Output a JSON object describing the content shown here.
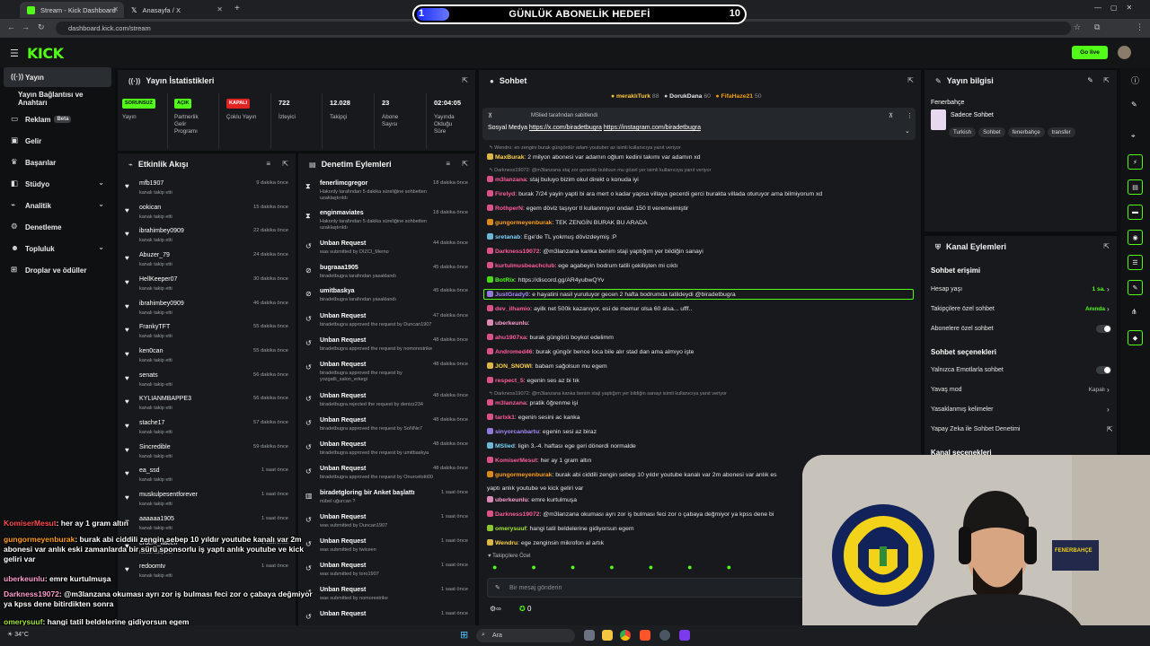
{
  "browser": {
    "tabs": [
      {
        "title": "Stream - Kick Dashboard",
        "active": true
      },
      {
        "title": "Anasayfa / X",
        "active": false
      }
    ],
    "url": "dashboard.kick.com/stream"
  },
  "goal": {
    "title": "GÜNLÜK ABONELİK HEDEFİ",
    "current": "1",
    "target": "10",
    "progress": 0.1
  },
  "header": {
    "logo": "KICK",
    "go_live": "Go live"
  },
  "sidebar": {
    "items": [
      {
        "label": "Yayın",
        "icon": "broadcast-icon",
        "active": true
      },
      {
        "label": "Yayın Bağlantısı ve Anahtarı",
        "icon": ""
      },
      {
        "label": "Reklam",
        "icon": "ad-icon",
        "badge": "Beta"
      },
      {
        "label": "Gelir",
        "icon": "revenue-icon"
      },
      {
        "label": "Başarılar",
        "icon": "trophy-icon"
      },
      {
        "label": "Stüdyo",
        "icon": "studio-icon",
        "expand": true
      },
      {
        "label": "Analitik",
        "icon": "analytics-icon",
        "expand": true
      },
      {
        "label": "Denetleme",
        "icon": "moderation-icon"
      },
      {
        "label": "Topluluk",
        "icon": "community-icon",
        "expand": true
      },
      {
        "label": "Droplar ve ödüller",
        "icon": "gift-icon"
      }
    ]
  },
  "stats": {
    "title": "Yayın İstatistikleri",
    "items": [
      {
        "badge": "SORUNSUZ",
        "label": "Yayın",
        "color": "green"
      },
      {
        "badge": "AÇIK",
        "label": "Partnerlik Gelir Programı",
        "color": "green"
      },
      {
        "badge": "KAPALI",
        "label": "Çoklu Yayın",
        "color": "red"
      },
      {
        "value": "722",
        "label": "İzleyici"
      },
      {
        "value": "12.028",
        "label": "Takipçi"
      },
      {
        "value": "23",
        "label": "Abone Sayısı"
      },
      {
        "value": "02:04:05",
        "label": "Yayında Olduğu Süre"
      }
    ]
  },
  "activity": {
    "title": "Etkinlik Akışı",
    "rows": [
      {
        "name": "mfb1907",
        "sub": "kanalı takip etti",
        "time": "9 dakika önce"
      },
      {
        "name": "ookican",
        "sub": "kanalı takip etti",
        "time": "15 dakika önce"
      },
      {
        "name": "ibrahimbey0909",
        "sub": "kanalı takip etti",
        "time": "22 dakika önce"
      },
      {
        "name": "Abuzer_79",
        "sub": "kanalı takip etti",
        "time": "24 dakika önce"
      },
      {
        "name": "HellKeeper07",
        "sub": "kanalı takip etti",
        "time": "30 dakika önce"
      },
      {
        "name": "ibrahimbey0909",
        "sub": "kanalı takip etti",
        "time": "46 dakika önce"
      },
      {
        "name": "FrankyTFT",
        "sub": "kanalı takip etti",
        "time": "55 dakika önce"
      },
      {
        "name": "ken0can",
        "sub": "kanalı takip etti",
        "time": "55 dakika önce"
      },
      {
        "name": "senats",
        "sub": "kanalı takip etti",
        "time": "56 dakika önce"
      },
      {
        "name": "KYLIANMBAPPE3",
        "sub": "kanalı takip etti",
        "time": "56 dakika önce"
      },
      {
        "name": "stache17",
        "sub": "kanalı takip etti",
        "time": "57 dakika önce"
      },
      {
        "name": "Sincredible",
        "sub": "kanalı takip etti",
        "time": "59 dakika önce"
      },
      {
        "name": "ea_ssd",
        "sub": "kanalı takip etti",
        "time": "1 saat önce"
      },
      {
        "name": "muskulpesentforever",
        "sub": "kanalı takip etti",
        "time": "1 saat önce"
      },
      {
        "name": "aaaaaa1905",
        "sub": "kanalı takip etti",
        "time": "1 saat önce"
      },
      {
        "name": "erdem_itacen",
        "sub": "kanalı takip etti",
        "time": "1 saat önce"
      },
      {
        "name": "redoomtv",
        "sub": "kanalı takip etti",
        "time": "1 saat önce"
      }
    ]
  },
  "moderation": {
    "title": "Denetim Eylemleri",
    "rows": [
      {
        "name": "fenerlimcgregor",
        "sub": "Hakonly tarafından 5 dakika süreliğine sohbetten uzaklaştırıldı",
        "time": "18 dakika önce",
        "icon": "hourglass-icon"
      },
      {
        "name": "enginmaviates",
        "sub": "Hakonly tarafından 5 dakika süreliğine sohbetten uzaklaştırıldı",
        "time": "18 dakika önce",
        "icon": "hourglass-icon"
      },
      {
        "name": "Unban Request",
        "sub": "was submitted by DIZCI_Memo",
        "time": "44 dakika önce",
        "icon": "history-icon"
      },
      {
        "name": "bugraaa1905",
        "sub": "biradetbugra tarafından yasaklandı",
        "time": "45 dakika önce",
        "icon": "ban-icon"
      },
      {
        "name": "umitbaskya",
        "sub": "biradetbugra tarafından yasaklandı",
        "time": "45 dakika önce",
        "icon": "ban-icon"
      },
      {
        "name": "Unban Request",
        "sub": "biradetbugra approved the request by Duncan1907",
        "time": "47 dakika önce",
        "icon": "history-icon"
      },
      {
        "name": "Unban Request",
        "sub": "biradetbugra approved the request by nomorestrike",
        "time": "48 dakika önce",
        "icon": "history-icon"
      },
      {
        "name": "Unban Request",
        "sub": "biradetbugra approved the request by yozgatli_salon_erkegi",
        "time": "48 dakika önce",
        "icon": "history-icon"
      },
      {
        "name": "Unban Request",
        "sub": "biradetbugra rejected the request by denizz234",
        "time": "48 dakika önce",
        "icon": "history-icon"
      },
      {
        "name": "Unban Request",
        "sub": "biradetbugra approved the request by SoNNe7",
        "time": "48 dakika önce",
        "icon": "history-icon"
      },
      {
        "name": "Unban Request",
        "sub": "biradetbugra approved the request by umitbaskya",
        "time": "48 dakika önce",
        "icon": "history-icon"
      },
      {
        "name": "Unban Request",
        "sub": "biradetbugra approved the request by Onurcelotti00",
        "time": "48 dakika önce",
        "icon": "history-icon"
      },
      {
        "name": "biradetgloring bir Anket başlattı",
        "sub": "nübel uğurcan ?",
        "time": "1 saat önce",
        "icon": "poll-icon"
      },
      {
        "name": "Unban Request",
        "sub": "was submitted by Duncan1907",
        "time": "1 saat önce",
        "icon": "history-icon"
      },
      {
        "name": "Unban Request",
        "sub": "was submitted by twiceen",
        "time": "1 saat önce",
        "icon": "history-icon"
      },
      {
        "name": "Unban Request",
        "sub": "was submitted by toro1907",
        "time": "1 saat önce",
        "icon": "history-icon"
      },
      {
        "name": "Unban Request",
        "sub": "was submitted by nomorestrike",
        "time": "1 saat önce",
        "icon": "history-icon"
      },
      {
        "name": "Unban Request",
        "sub": "",
        "time": "1 saat önce",
        "icon": "history-icon"
      }
    ]
  },
  "chat": {
    "title": "Sohbet",
    "top_gifters": [
      {
        "name": "meraklıTurk",
        "count": "88"
      },
      {
        "name": "DorukDana",
        "count": "60"
      },
      {
        "name": "FifaHaze21",
        "count": "50"
      }
    ],
    "pinned": {
      "by": "MSlied tarafından sabitlendi",
      "text_prefix": "Sosyal Medya ",
      "link1": "https://x.com/biradetbugra",
      "link2": "https://instagram.com/biradetbugra"
    },
    "messages": [
      {
        "type": "reply",
        "text": "Wendru: en zengini burak güngördür adam youtuber az isimli kullanıcıya yanıt veriyor"
      },
      {
        "type": "msg",
        "user": "MaxBurak",
        "color": "#ffd24d",
        "text": "2 milyon abonesi var adamın oğlum kedini takımı var adamın xd"
      },
      {
        "type": "reply",
        "text": "Darkness19072: @m3lanzana staj zor genelde bulduun mu gözel yer isimli kullanıcıya yanıt veriyor"
      },
      {
        "type": "msg",
        "user": "m3lanzana",
        "color": "#ff5c9d",
        "text": "staj buluyo bizim okul direkt o konuda iyi"
      },
      {
        "type": "msg",
        "user": "Firelyd",
        "color": "#ff5c9d",
        "text": "burak 7/24 yayin yapti bi ara mert o kadar yapsa villaya gecerdi gerci burakta villada oturuyor ama bilmiyorum xd"
      },
      {
        "type": "msg",
        "user": "RothperN",
        "color": "#ff5c9d",
        "text": "egem döviz taşıyor tl kullanmıyor ondan 150 tl veremeimiştir"
      },
      {
        "type": "msg",
        "user": "gungormeyenburak",
        "color": "#ff9f1c",
        "text": "TEK ZENGİN BURAK BU ARADA"
      },
      {
        "type": "msg",
        "user": "sretanab",
        "color": "#7dd3fc",
        "text": "Ege'de TL yokmuş dövizdeymiş :P"
      },
      {
        "type": "msg",
        "user": "Darkness19072",
        "color": "#ff5c9d",
        "text": "@m3lanzana kanka benim staji yaptığım yer bildiğin sanayi"
      },
      {
        "type": "msg",
        "user": "kurtulmusbeachclub",
        "color": "#ff5c9d",
        "text": "ege agabeyin bodrum tatili çekilişten mi cıktı"
      },
      {
        "type": "msg",
        "user": "BotRix",
        "color": "#53fc18",
        "text": "https://discord.gg/AR4yubwQYv"
      },
      {
        "type": "highlight",
        "user": "JustGrady0",
        "color": "#a78bfa",
        "text": "e hayatini nasil yurutuyor gecen 2 hafta bodrumda tatildeydi @biradetbugra"
      },
      {
        "type": "msg",
        "user": "dev_ilhamio",
        "color": "#ff5c9d",
        "text": "ayilk net 500k kazanıyor, esi de memur olsa 60 alsa... ufff.."
      },
      {
        "type": "msg",
        "user": "uberkeunlu",
        "color": "#ff9fd0",
        "text": ""
      },
      {
        "type": "msg",
        "user": "ahu1907xa",
        "color": "#ff5c9d",
        "text": "burak güngörü boykot edelimm"
      },
      {
        "type": "msg",
        "user": "Andromed46",
        "color": "#ff5c9d",
        "text": "burak güngör bence loca bile alır stad dan ama almıyo işte"
      },
      {
        "type": "msg",
        "user": "JON_SNOWl",
        "color": "#ffd24d",
        "text": "babam sağolsun mu egem"
      },
      {
        "type": "msg",
        "user": "respect_5",
        "color": "#ff5c9d",
        "text": "egenin ses az bi tık"
      },
      {
        "type": "reply",
        "text": "Darkness19072: @m3lanzana kanka benim staji yaptığım yer bildiğin sanayi isimli kullanıcıya yanıt veriyor"
      },
      {
        "type": "msg",
        "user": "m3lanzana",
        "color": "#ff5c9d",
        "text": "pratik öğrenme işi"
      },
      {
        "type": "msg",
        "user": "tarlxk1",
        "color": "#ff5c9d",
        "text": "egenin sesini ac kanka"
      },
      {
        "type": "msg",
        "user": "sinyorcanbartu",
        "color": "#a78bfa",
        "text": "egenin sesi az biraz"
      },
      {
        "type": "msg",
        "user": "MSlied",
        "color": "#7dd3fc",
        "text": "ligin 3.-4. haftası ege geri dönerdi normalde"
      },
      {
        "type": "msg",
        "user": "KomiserMesut",
        "color": "#ff5c9d",
        "text": "her ay 1 gram altın"
      },
      {
        "type": "msg",
        "user": "gungormeyenburak",
        "color": "#ff9f1c",
        "text": "burak abi ciddili zengin sebep 10 yıldır youtube kanalı var 2m abonesi var anlık es"
      },
      {
        "type": "cont",
        "text": "yaptı anlık youtube ve kick geliri var"
      },
      {
        "type": "msg",
        "user": "uberkeunlu",
        "color": "#ff9fd0",
        "text": "emre kurtulmuşa"
      },
      {
        "type": "msg",
        "user": "Darkness19072",
        "color": "#ff5c9d",
        "text": "@m3lanzana okuması ayrı zor iş bulması feci zor o çabaya değmiyor ya kpss dene bi"
      },
      {
        "type": "msg",
        "user": "omerysuuf",
        "color": "#a3e635",
        "text": "hangi tatil beldelerine gidiyorsun egem"
      },
      {
        "type": "msg",
        "user": "Wendru",
        "color": "#ffd24d",
        "text": "ege zenginsin mikrofon al artık"
      }
    ],
    "followers_only": "Takipçilere Özel",
    "input_placeholder": "Bir mesaj gönderin",
    "points": "0"
  },
  "stream_info": {
    "title": "Yayın bilgisi",
    "category": "Fenerbahçe",
    "subtitle": "Sadece Sohbet",
    "tags": [
      "Turkish",
      "Sohbet",
      "fenerbahçe",
      "transfer"
    ]
  },
  "channel_actions": {
    "title": "Kanal Eylemleri",
    "chat_access": "Sohbet erişimi",
    "rows1": [
      {
        "label": "Hesap yaşı",
        "value": "1 sa."
      },
      {
        "label": "Takipçilere özel sohbet",
        "value": "Anında"
      },
      {
        "label": "Abonelere özel sohbet",
        "toggle": true
      }
    ],
    "chat_options": "Sohbet seçenekleri",
    "rows2": [
      {
        "label": "Yalnızca Emotlarla sohbet",
        "toggle": true
      },
      {
        "label": "Yavaş mod",
        "value": "Kapalı"
      },
      {
        "label": "Yasaklanmış kelimeler",
        "value": ""
      },
      {
        "label": "Yapay Zeka ile Sohbet Denetimi",
        "value": ""
      }
    ],
    "channel_options": "Kanal seçenekleri"
  },
  "overlay_chat": [
    {
      "user": "KomiserMesut",
      "color": "#ff4d4d",
      "text": ": her ay 1 gram altın"
    },
    {
      "user": "gungormeyenburak",
      "color": "#ff9f1c",
      "text": ": burak abi ciddili zengin sebep 10 yıldır youtube kanalı var 2m abonesi var anlık eski zamanlarda bir sürü sponsorlu iş yaptı anlık youtube ve kick geliri var"
    },
    {
      "user": "uberkeunlu",
      "color": "#ff9fd0",
      "text": ": emre kurtulmuşa"
    },
    {
      "user": "Darkness19072",
      "color": "#ff9fd0",
      "text": ": @m3lanzana okuması ayrı zor iş bulması feci zor o çabaya değmiyor ya kpss dene bitirdikten sonra"
    },
    {
      "user": "omerysuuf",
      "color": "#a3e635",
      "text": ": hangi tatil beldelerine gidiyorsun egem"
    },
    {
      "user": "Wendru",
      "color": "#ffd24d",
      "text": ": ege zenginsin mikrofon al artık"
    }
  ],
  "taskbar": {
    "search": "Ara",
    "weather": "34°C"
  },
  "webcam": {
    "scarf_text": "FENERBAHÇE",
    "crest_text": "FENERBAHÇE SPOR KULÜBÜ 1907"
  }
}
